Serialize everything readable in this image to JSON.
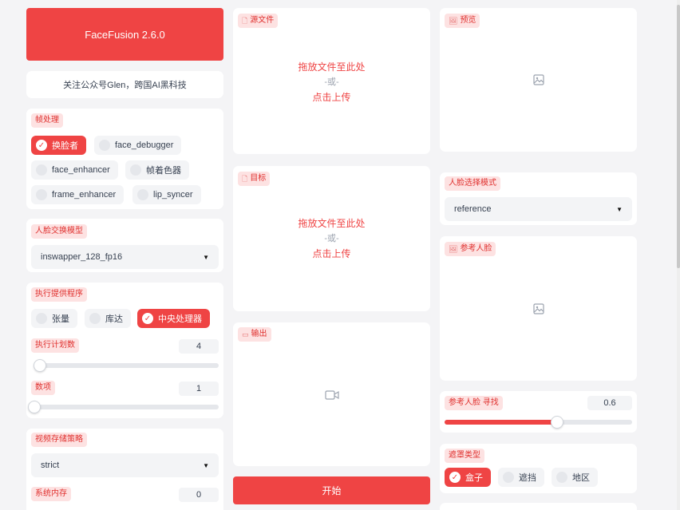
{
  "app": {
    "title": "FaceFusion 2.6.0",
    "subtitle": "关注公众号Glen，跨国AI黑科技",
    "accent_color": "#ef4444"
  },
  "frame_processors": {
    "label": "帧处理",
    "options": [
      {
        "label": "换脸者",
        "checked": true
      },
      {
        "label": "face_debugger",
        "checked": false
      },
      {
        "label": "face_enhancer",
        "checked": false
      },
      {
        "label": "帧着色器",
        "checked": false
      },
      {
        "label": "frame_enhancer",
        "checked": false
      },
      {
        "label": "lip_syncer",
        "checked": false
      }
    ]
  },
  "face_swapper_model": {
    "label": "人脸交换模型",
    "value": "inswapper_128_fp16"
  },
  "execution_providers": {
    "label": "执行提供程序",
    "options": [
      {
        "label": "张量",
        "checked": false
      },
      {
        "label": "库达",
        "checked": false
      },
      {
        "label": "中央处理器",
        "checked": true
      }
    ]
  },
  "execution_thread_count": {
    "label": "执行计划数",
    "value": "4",
    "fraction": 0.03
  },
  "execution_queue_count": {
    "label": "数项",
    "value": "1",
    "fraction": 0.0
  },
  "video_memory_strategy": {
    "label": "视频存储策略",
    "value": "strict"
  },
  "system_memory_limit": {
    "label": "系统内存",
    "value": "0"
  },
  "source": {
    "label": "源文件",
    "drop_line1": "拖放文件至此处",
    "drop_or": "-或-",
    "drop_line2": "点击上传"
  },
  "target": {
    "label": "目标",
    "drop_line1": "拖放文件至此处",
    "drop_or": "-或-",
    "drop_line2": "点击上传"
  },
  "output": {
    "label": "输出"
  },
  "start_button": {
    "label": "开始"
  },
  "preview": {
    "label": "预览"
  },
  "face_selector_mode": {
    "label": "人脸选择模式",
    "value": "reference"
  },
  "reference_face": {
    "label": "参考人脸"
  },
  "reference_face_distance": {
    "label": "参考人脸 寻找",
    "value": "0.6",
    "fraction": 0.6
  },
  "face_mask_types": {
    "label": "遮罩类型",
    "options": [
      {
        "label": "盒子",
        "checked": true
      },
      {
        "label": "遮挡",
        "checked": false
      },
      {
        "label": "地区",
        "checked": false
      }
    ]
  }
}
